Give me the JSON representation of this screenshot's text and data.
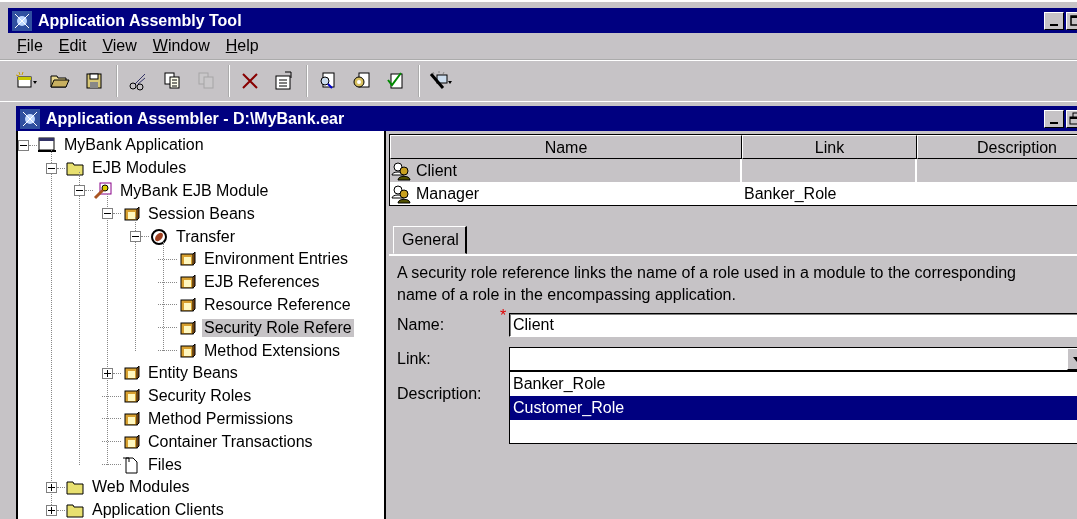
{
  "window": {
    "title": "Application Assembly Tool"
  },
  "menu": [
    {
      "label": "File"
    },
    {
      "label": "Edit"
    },
    {
      "label": "View"
    },
    {
      "label": "Window"
    },
    {
      "label": "Help"
    }
  ],
  "toolbar": [
    [
      {
        "kind": "new",
        "disabled": false
      },
      {
        "kind": "open",
        "disabled": false
      },
      {
        "kind": "save",
        "disabled": false
      }
    ],
    [
      {
        "kind": "cut",
        "disabled": false
      },
      {
        "kind": "copy",
        "disabled": false
      },
      {
        "kind": "paste",
        "disabled": true
      }
    ],
    [
      {
        "kind": "delete",
        "disabled": false
      },
      {
        "kind": "properties",
        "disabled": false
      }
    ],
    [
      {
        "kind": "find",
        "disabled": false
      },
      {
        "kind": "generate",
        "disabled": false
      },
      {
        "kind": "verify",
        "disabled": false
      }
    ],
    [
      {
        "kind": "wizard",
        "disabled": false
      }
    ]
  ],
  "inner_window": {
    "title": "Application Assembler - D:\\MyBank.ear"
  },
  "tree": [
    {
      "label": "MyBank Application",
      "kind": "app",
      "expanded": true,
      "selected": false,
      "children": [
        {
          "label": "EJB Modules",
          "kind": "folder",
          "expanded": true,
          "selected": false,
          "children": [
            {
              "label": "MyBank EJB Module",
              "kind": "module",
              "expanded": true,
              "selected": false,
              "children": [
                {
                  "label": "Session Beans",
                  "kind": "bean",
                  "expanded": true,
                  "selected": false,
                  "children": [
                    {
                      "label": "Transfer",
                      "kind": "session",
                      "expanded": true,
                      "selected": false,
                      "children": [
                        {
                          "label": "Environment Entries",
                          "kind": "bean",
                          "selected": false
                        },
                        {
                          "label": "EJB References",
                          "kind": "bean",
                          "selected": false
                        },
                        {
                          "label": "Resource Reference",
                          "kind": "bean",
                          "selected": false
                        },
                        {
                          "label": "Security Role Refere",
                          "kind": "bean",
                          "selected": true
                        },
                        {
                          "label": "Method Extensions",
                          "kind": "bean",
                          "selected": false
                        }
                      ]
                    }
                  ]
                },
                {
                  "label": "Entity Beans",
                  "kind": "bean",
                  "expanded": false,
                  "selected": false
                },
                {
                  "label": "Security Roles",
                  "kind": "bean",
                  "selected": false
                },
                {
                  "label": "Method Permissions",
                  "kind": "bean",
                  "selected": false
                },
                {
                  "label": "Container Transactions",
                  "kind": "bean",
                  "selected": false
                },
                {
                  "label": "Files",
                  "kind": "file",
                  "selected": false
                }
              ]
            }
          ]
        },
        {
          "label": "Web Modules",
          "kind": "folder",
          "expanded": false,
          "selected": false
        },
        {
          "label": "Application Clients",
          "kind": "folder",
          "expanded": false,
          "selected": false
        }
      ]
    }
  ],
  "table": {
    "columns": [
      "Name",
      "Link",
      "Description"
    ],
    "rows": [
      {
        "name": "Client",
        "link": "",
        "selected": true
      },
      {
        "name": "Manager",
        "link": "Banker_Role",
        "selected": false
      }
    ]
  },
  "tabs": [
    {
      "label": "General",
      "selected": true
    }
  ],
  "form": {
    "description": "A security role reference links the name of a role used in a module to the corresponding name of a role in the encompassing application.",
    "name_label": "Name:",
    "name_required": true,
    "required_mark": "*",
    "name_value": "Client",
    "link_label": "Link:",
    "description_label": "Description:",
    "link_options": [
      {
        "label": "Banker_Role",
        "selected": false
      },
      {
        "label": "Customer_Role",
        "selected": true
      }
    ]
  }
}
